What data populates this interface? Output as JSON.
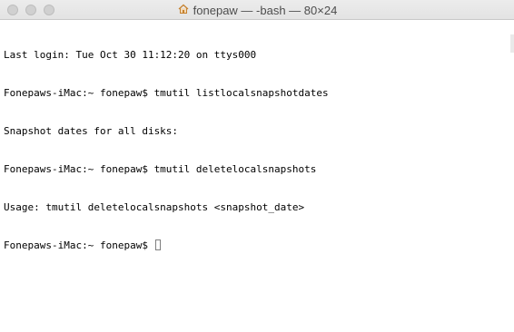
{
  "window": {
    "title": "fonepaw — -bash — 80×24"
  },
  "terminal": {
    "lines": [
      "Last login: Tue Oct 30 11:12:20 on ttys000",
      "Fonepaws-iMac:~ fonepaw$ tmutil listlocalsnapshotdates",
      "Snapshot dates for all disks:",
      "Fonepaws-iMac:~ fonepaw$ tmutil deletelocalsnapshots",
      "Usage: tmutil deletelocalsnapshots <snapshot_date>"
    ],
    "prompt": "Fonepaws-iMac:~ fonepaw$ "
  },
  "colors": {
    "background": "#ffffff",
    "text": "#000000",
    "titlebar": "#e6e6e6"
  },
  "icons": {
    "title_icon": "home-icon"
  }
}
